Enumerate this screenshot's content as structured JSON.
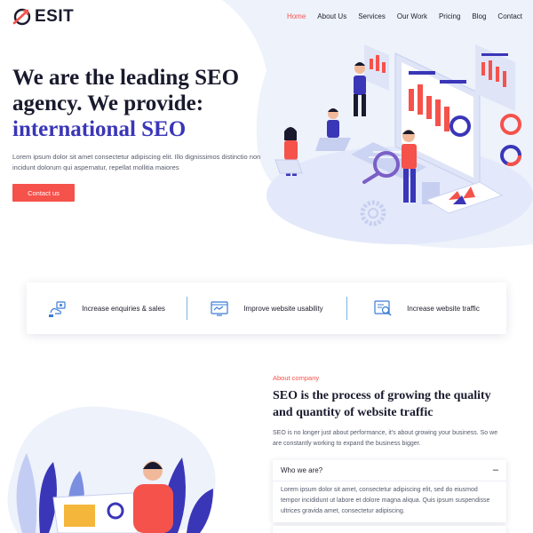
{
  "colors": {
    "accent": "#f5524b",
    "brand_blue": "#3a36b8",
    "text_dark": "#1a1a2e",
    "text_muted": "#555a6b",
    "hero_bg": "#eef2fb"
  },
  "header": {
    "logo_text": "ESIT",
    "nav": [
      "Home",
      "About Us",
      "Services",
      "Our Work",
      "Pricing",
      "Blog",
      "Contact"
    ],
    "active_nav": "Home"
  },
  "hero": {
    "title_line1": "We are the leading SEO",
    "title_line2": "agency. We provide:",
    "title_accent": "international SEO",
    "description": "Lorem ipsum dolor sit amet consectetur adipiscing elit. Illo dignissimos distinctio non incidunt dolorum qui aspernatur, repellat mollitia maiores",
    "cta_label": "Contact us"
  },
  "features": [
    {
      "icon": "enquiries-icon",
      "label": "Increase enquiries & sales"
    },
    {
      "icon": "usability-icon",
      "label": "Improve website usability"
    },
    {
      "icon": "traffic-icon",
      "label": "Increase website traffic"
    }
  ],
  "about": {
    "kicker": "About company",
    "title": "SEO is the process of growing the quality and quantity of website traffic",
    "description": "SEO is no longer just about performance, it's about growing your business. So we are constantly working to expand the business bigger.",
    "accordion": [
      {
        "title": "Who we are?",
        "toggle": "–",
        "body": "Lorem ipsum dolor sit amet, consectetur adipiscing elit, sed do eiusmod tempor incididunt ut labore et dolore magna aliqua. Quis ipsum suspendisse ultrices gravida amet, consectetur adipiscing."
      }
    ]
  }
}
